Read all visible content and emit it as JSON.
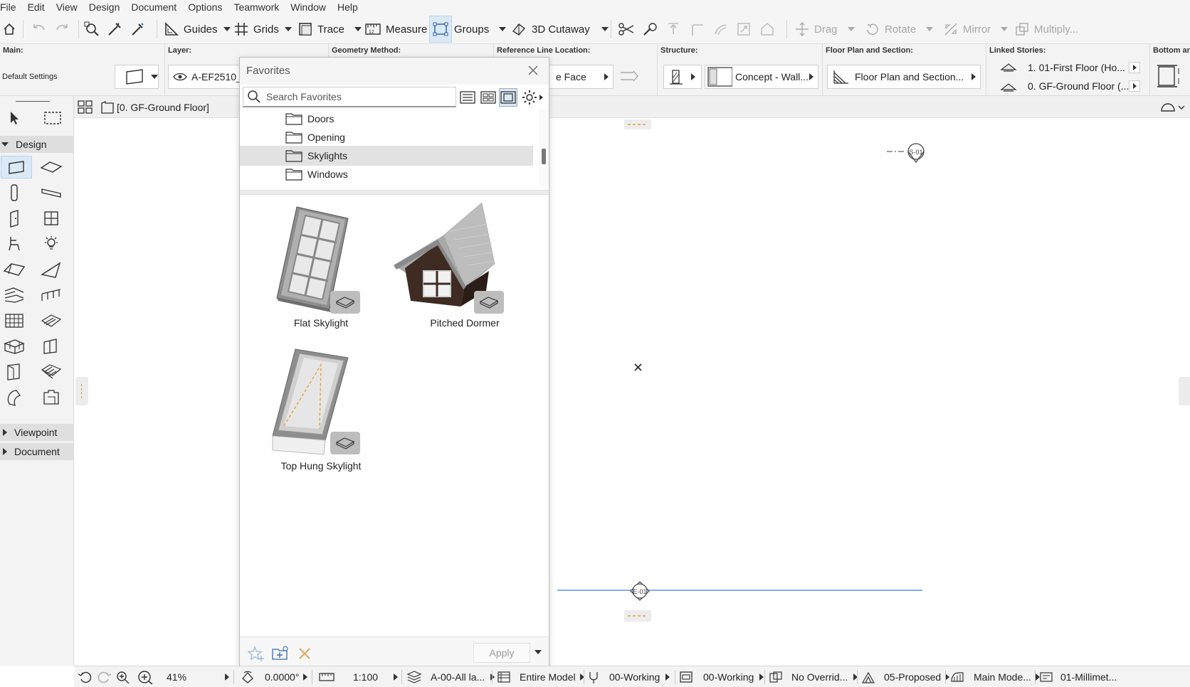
{
  "menu": [
    "File",
    "Edit",
    "View",
    "Design",
    "Document",
    "Options",
    "Teamwork",
    "Window",
    "Help"
  ],
  "toolbar": {
    "guides": "Guides",
    "grids": "Grids",
    "trace": "Trace",
    "measure": "Measure",
    "groups": "Groups",
    "cutaway": "3D Cutaway",
    "drag": "Drag",
    "rotate": "Rotate",
    "mirror": "Mirror",
    "multiply": "Multiply..."
  },
  "infobox": {
    "main_hdr": "Main:",
    "main_value": "Default Settings",
    "layer_hdr": "Layer:",
    "layer_value": "A-EF2510_",
    "geometry_hdr": "Geometry Method:",
    "refline_hdr": "Reference Line Location:",
    "refline_value": "e Face",
    "structure_hdr": "Structure:",
    "structure_value": "Concept - Wall...",
    "floorplan_hdr": "Floor Plan and Section:",
    "floorplan_value": "Floor Plan and Section...",
    "linked_hdr": "Linked Stories:",
    "linked_top": "1. 01-First Floor (Ho...",
    "linked_bottom": "0. GF-Ground Floor (...",
    "bottom_hdr": "Bottom an"
  },
  "toolbox": {
    "design": "Design",
    "viewpoint": "Viewpoint",
    "document": "Document"
  },
  "tab": {
    "label": "[0. GF-Ground Floor]"
  },
  "canvas": {
    "marker_s": "S-01",
    "marker_e": "E-01"
  },
  "favorites": {
    "title": "Favorites",
    "search_placeholder": "Search Favorites",
    "folders": [
      {
        "label": "Doors",
        "selected": false
      },
      {
        "label": "Opening",
        "selected": false
      },
      {
        "label": "Skylights",
        "selected": true
      },
      {
        "label": "Windows",
        "selected": false
      }
    ],
    "items": [
      {
        "label": "Flat Skylight",
        "icon": "flat-skylight"
      },
      {
        "label": "Pitched Dormer",
        "icon": "pitched-dormer"
      },
      {
        "label": "Top Hung Skylight",
        "icon": "top-hung-skylight"
      }
    ],
    "apply": "Apply"
  },
  "status": {
    "zoom": "41%",
    "angle": "0.0000°",
    "scale": "1:100",
    "layer_combo": "A-00-All la...",
    "model_view": "Entire Model",
    "pen_set": "00-Working",
    "view_option": "00-Working",
    "override": "No Overrid...",
    "renovation": "05-Proposed",
    "model_option": "Main Mode...",
    "dimension": "01-Millimet..."
  },
  "colors": {
    "accent": "#dbe9f6",
    "panel": "#f3f3f3",
    "selection": "#e2e2e2",
    "orange_dash": "#e8a040",
    "blue_line": "#3d7bd9"
  }
}
